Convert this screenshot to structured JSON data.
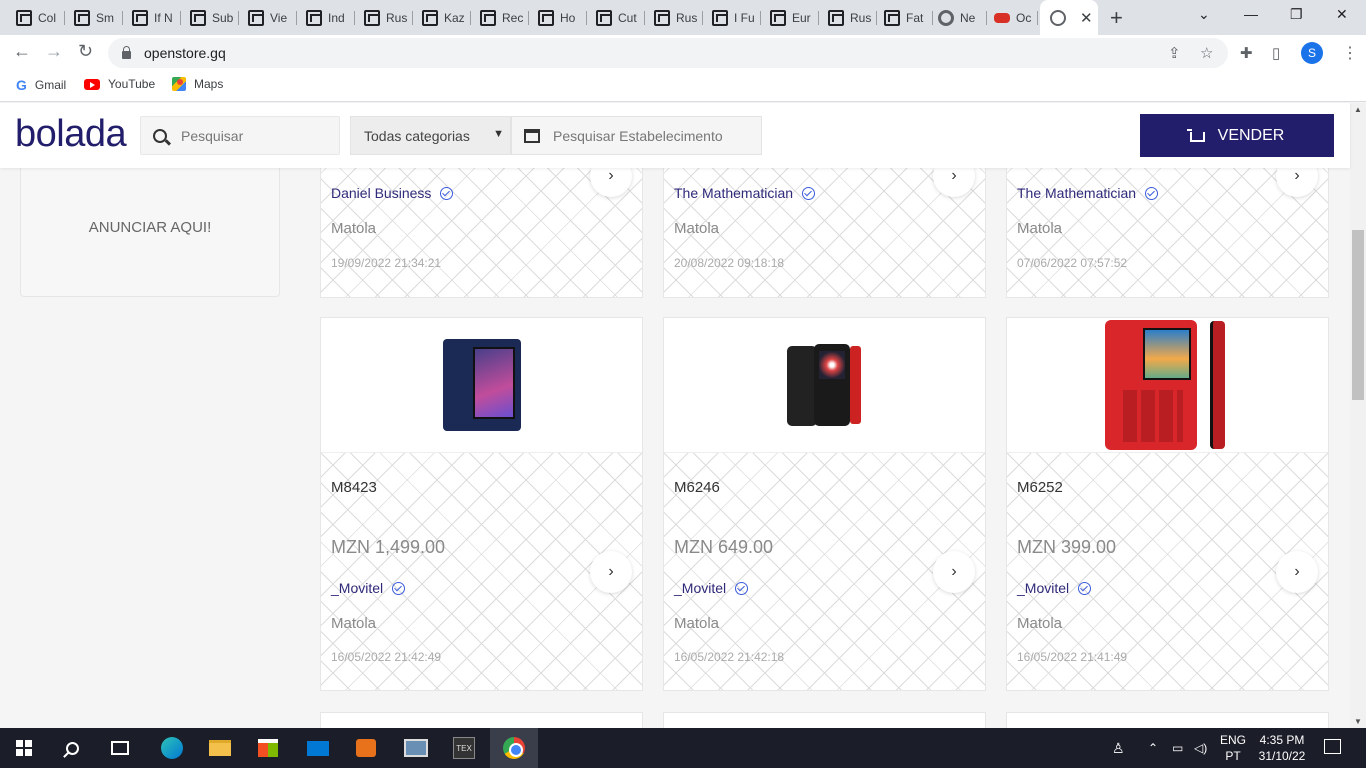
{
  "browser": {
    "tabs": [
      {
        "title": "Col",
        "icon": "site-icon"
      },
      {
        "title": "Sm",
        "icon": "site-icon"
      },
      {
        "title": "If N",
        "icon": "site-icon"
      },
      {
        "title": "Sub",
        "icon": "site-icon"
      },
      {
        "title": "Vie",
        "icon": "site-icon"
      },
      {
        "title": "Ind",
        "icon": "site-icon"
      },
      {
        "title": "Rus",
        "icon": "site-icon"
      },
      {
        "title": "Kaz",
        "icon": "site-icon"
      },
      {
        "title": "Rec",
        "icon": "site-icon"
      },
      {
        "title": "Ho",
        "icon": "site-icon"
      },
      {
        "title": "Cut",
        "icon": "site-icon"
      },
      {
        "title": "Rus",
        "icon": "site-icon"
      },
      {
        "title": "I Fu",
        "icon": "site-icon"
      },
      {
        "title": "Eur",
        "icon": "site-icon"
      },
      {
        "title": "Rus",
        "icon": "site-icon"
      },
      {
        "title": "Fat",
        "icon": "site-icon"
      },
      {
        "title": "Ne",
        "icon": "chrome-icon"
      },
      {
        "title": "Oc",
        "icon": "game-icon"
      }
    ],
    "active_tab_close": "✕",
    "url": "openstore.gq",
    "profile_initial": "S",
    "bookmarks": [
      "Gmail",
      "YouTube",
      "Maps"
    ]
  },
  "site": {
    "logo": "bolada",
    "search_placeholder": "Pesquisar",
    "category_select": "Todas categorias",
    "store_search_placeholder": "Pesquisar Estabelecimento",
    "sell_button": "VENDER",
    "ad_text": "ANUNCIAR AQUI!"
  },
  "top_cards": [
    {
      "seller": "Daniel Business",
      "city": "Matola",
      "date": "19/09/2022 21:34:21"
    },
    {
      "seller": "The Mathematician",
      "city": "Matola",
      "date": "20/08/2022 09:18:18"
    },
    {
      "seller": "The Mathematician",
      "city": "Matola",
      "date": "07/06/2022 07:57:52"
    }
  ],
  "products": [
    {
      "name": "M8423",
      "price": "MZN 1,499.00",
      "seller": "_Movitel",
      "city": "Matola",
      "date": "16/05/2022 21:42:49"
    },
    {
      "name": "M6246",
      "price": "MZN 649.00",
      "seller": "_Movitel",
      "city": "Matola",
      "date": "16/05/2022 21:42:18"
    },
    {
      "name": "M6252",
      "price": "MZN 399.00",
      "seller": "_Movitel",
      "city": "Matola",
      "date": "16/05/2022 21:41:49"
    }
  ],
  "taskbar": {
    "language": "ENG",
    "layout": "PT",
    "time": "4:35 PM",
    "date": "31/10/22"
  },
  "colors": {
    "brand": "#231e6b",
    "verified": "#3b5bdb"
  }
}
